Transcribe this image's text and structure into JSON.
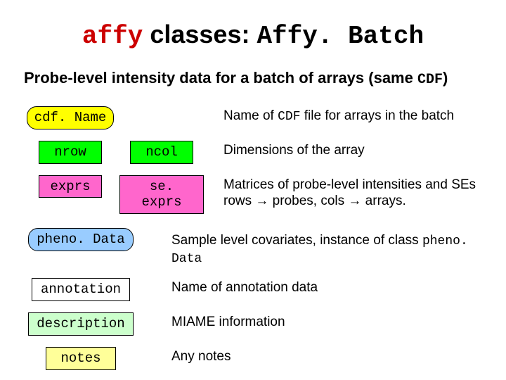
{
  "title": {
    "affy": "affy",
    "classes_word": " classes: ",
    "classname": "Affy. Batch"
  },
  "subtitle": {
    "text_before": "Probe-level intensity data for a batch of arrays (same ",
    "cdf": "CDF",
    "text_after": ")"
  },
  "rows": {
    "cdfName": {
      "box1": "cdf. Name",
      "desc_before": "Name of ",
      "desc_cdf": "CDF",
      "desc_after": " file for arrays in the batch"
    },
    "dim": {
      "box1": "nrow",
      "box2": "ncol",
      "desc": "Dimensions of the array"
    },
    "exprs": {
      "box1": "exprs",
      "box2": "se. exprs",
      "desc_l1": "Matrices of probe-level intensities and SEs",
      "desc_l2a": "rows ",
      "desc_arrow1": "→",
      "desc_l2b": " probes, cols ",
      "desc_arrow2": "→",
      "desc_l2c": " arrays."
    },
    "pheno": {
      "box1": "pheno. Data",
      "desc_before": "Sample level covariates, instance of class ",
      "desc_mono": "pheno. Data"
    },
    "annotation": {
      "box1": "annotation",
      "desc": "Name of annotation data"
    },
    "description": {
      "box1": "description",
      "desc": "MIAME information"
    },
    "notes": {
      "box1": "notes",
      "desc": "Any notes"
    }
  }
}
